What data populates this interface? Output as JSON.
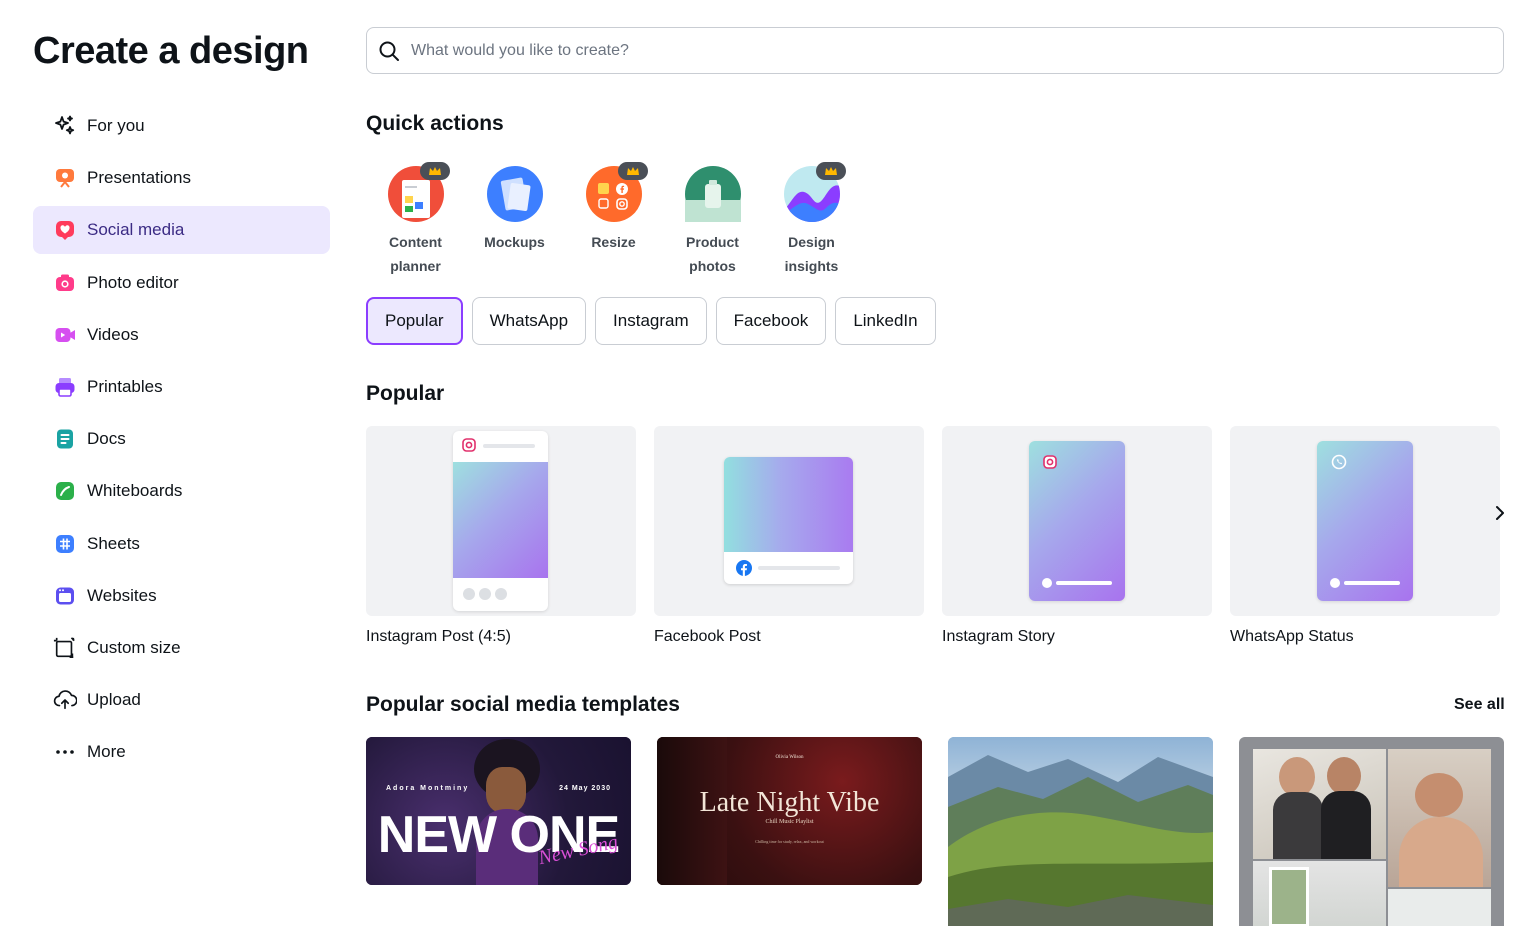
{
  "title": "Create a design",
  "sidebar": {
    "items": [
      {
        "label": "For you",
        "icon": "sparkles-icon"
      },
      {
        "label": "Presentations",
        "icon": "presentation-icon",
        "color": "#ff7a3d"
      },
      {
        "label": "Social media",
        "icon": "heart-icon",
        "color": "#ff3b5c",
        "active": true
      },
      {
        "label": "Photo editor",
        "icon": "camera-icon",
        "color": "#ff3b8a"
      },
      {
        "label": "Videos",
        "icon": "video-icon",
        "color": "#d64ff0"
      },
      {
        "label": "Printables",
        "icon": "printer-icon",
        "color": "#8b3dff"
      },
      {
        "label": "Docs",
        "icon": "doc-icon",
        "color": "#1aa3a3"
      },
      {
        "label": "Whiteboards",
        "icon": "whiteboard-icon",
        "color": "#2bb04a"
      },
      {
        "label": "Sheets",
        "icon": "sheets-icon",
        "color": "#3d7fff"
      },
      {
        "label": "Websites",
        "icon": "website-icon",
        "color": "#5c4ff0"
      },
      {
        "label": "Custom size",
        "icon": "custom-size-icon"
      },
      {
        "label": "Upload",
        "icon": "upload-cloud-icon"
      },
      {
        "label": "More",
        "icon": "more-icon"
      }
    ]
  },
  "search": {
    "placeholder": "What would you like to create?"
  },
  "quick_actions": {
    "title": "Quick actions",
    "items": [
      {
        "line1": "Content",
        "line2": "planner",
        "premium": true
      },
      {
        "line1": "Mockups",
        "line2": "",
        "premium": false
      },
      {
        "line1": "Resize",
        "line2": "",
        "premium": true
      },
      {
        "line1": "Product",
        "line2": "photos",
        "premium": false
      },
      {
        "line1": "Design",
        "line2": "insights",
        "premium": true
      }
    ]
  },
  "chips": [
    "Popular",
    "WhatsApp",
    "Instagram",
    "Facebook",
    "LinkedIn"
  ],
  "popular": {
    "title": "Popular",
    "cards": [
      "Instagram Post (4:5)",
      "Facebook Post",
      "Instagram Story",
      "WhatsApp Status"
    ]
  },
  "templates": {
    "title": "Popular social media templates",
    "see_all": "See all",
    "t1": {
      "name": "Adora Montminy",
      "date": "24 May 2030",
      "headline": "NEW ONE",
      "script": "New Song"
    },
    "t2": {
      "small": "Olivia Wilson",
      "headline": "Late Night Vibe",
      "sub": "Chill Music Playlist",
      "fine": "Chilling time for study, relax, and workout"
    }
  }
}
